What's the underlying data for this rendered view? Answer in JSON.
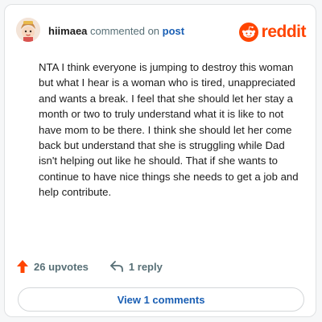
{
  "header": {
    "username": "hiimaea",
    "verb": "commented on",
    "post_link": "post",
    "brand": "reddit"
  },
  "comment": {
    "text": "NTA I think everyone is jumping to destroy this woman but what I hear is a woman who is tired, unappreciated and wants a break. I feel that she should let her stay a month or two to truly understand what it is like to not have mom to be there. I think she should let her come back but understand that she is struggling while Dad isn't helping out like he should. That if she wants to continue to have nice things she needs to get a job and help contribute."
  },
  "actions": {
    "upvotes_label": "26 upvotes",
    "replies_label": "1 reply",
    "upvote_icon": "arrow-up-icon",
    "reply_icon": "reply-icon"
  },
  "footer": {
    "view_comments_label": "View 1 comments"
  },
  "colors": {
    "brand": "#ff4500",
    "link": "#1a5fb4",
    "muted": "#576f76"
  }
}
